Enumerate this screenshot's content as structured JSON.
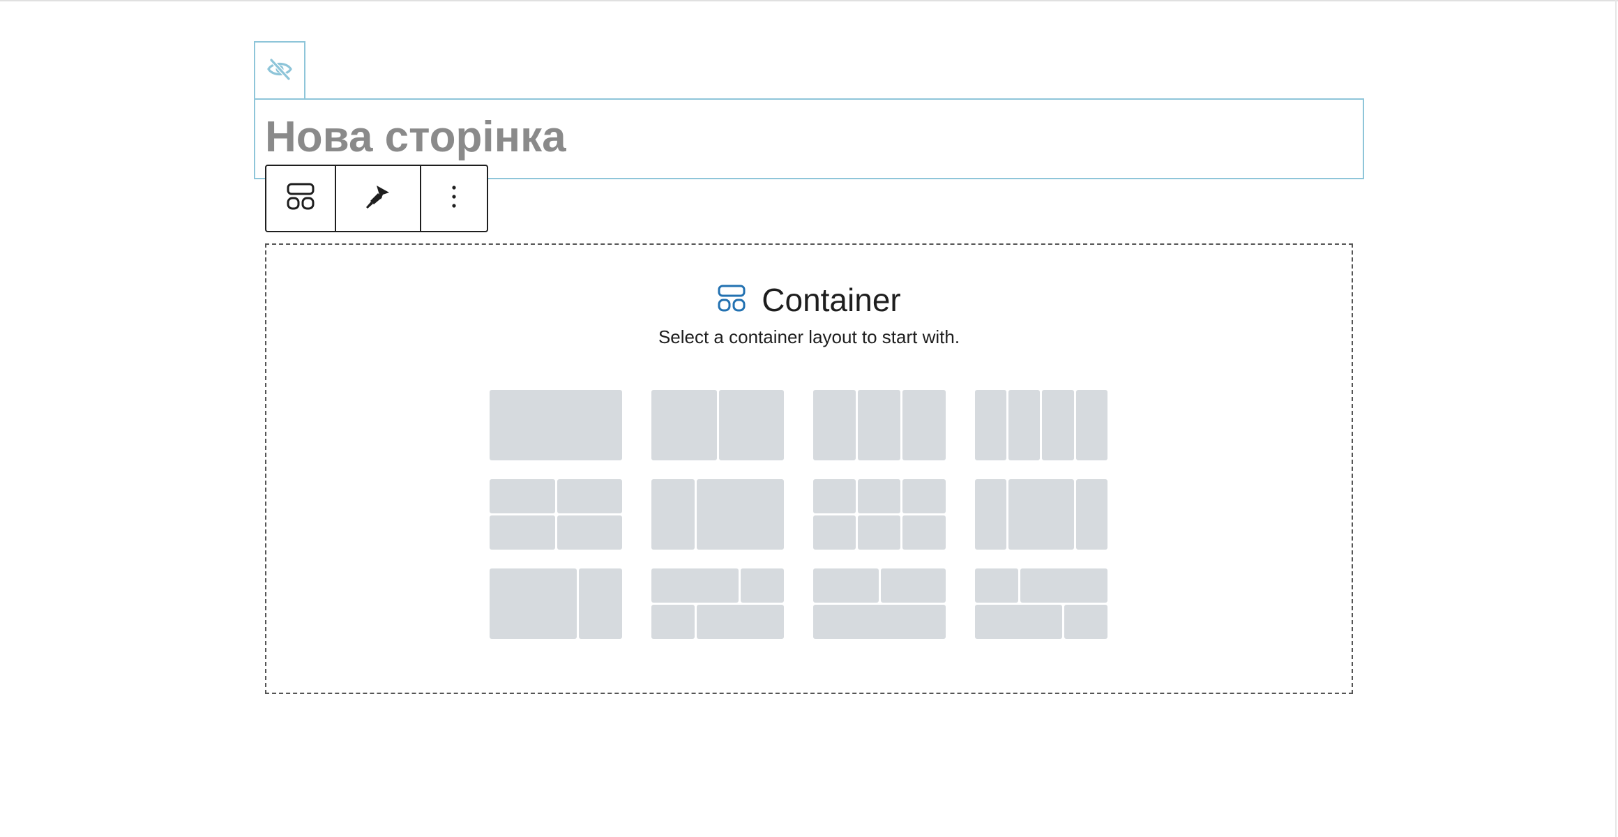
{
  "page": {
    "title": "Нова сторінка"
  },
  "icons": {
    "visibility": "eye-off-icon",
    "block_type": "container-layout-icon",
    "style": "paintbrush-icon",
    "options": "more-vertical-icon"
  },
  "colors": {
    "accent_blue": "#2271b1",
    "frame_blue": "#8ec5d9",
    "title_gray": "#8a8a8a",
    "cell_gray": "#d6dade"
  },
  "container": {
    "title": "Container",
    "instructions": "Select a container layout to start with.",
    "layouts": [
      {
        "id": "100"
      },
      {
        "id": "50-50"
      },
      {
        "id": "33-33-33"
      },
      {
        "id": "25-25-25-25"
      },
      {
        "id": "2x2"
      },
      {
        "id": "33-66"
      },
      {
        "id": "3x2"
      },
      {
        "id": "25-50-25"
      },
      {
        "id": "66-33"
      },
      {
        "id": "66-33_33-66"
      },
      {
        "id": "50-50_100"
      },
      {
        "id": "33-66_66-33"
      }
    ]
  }
}
